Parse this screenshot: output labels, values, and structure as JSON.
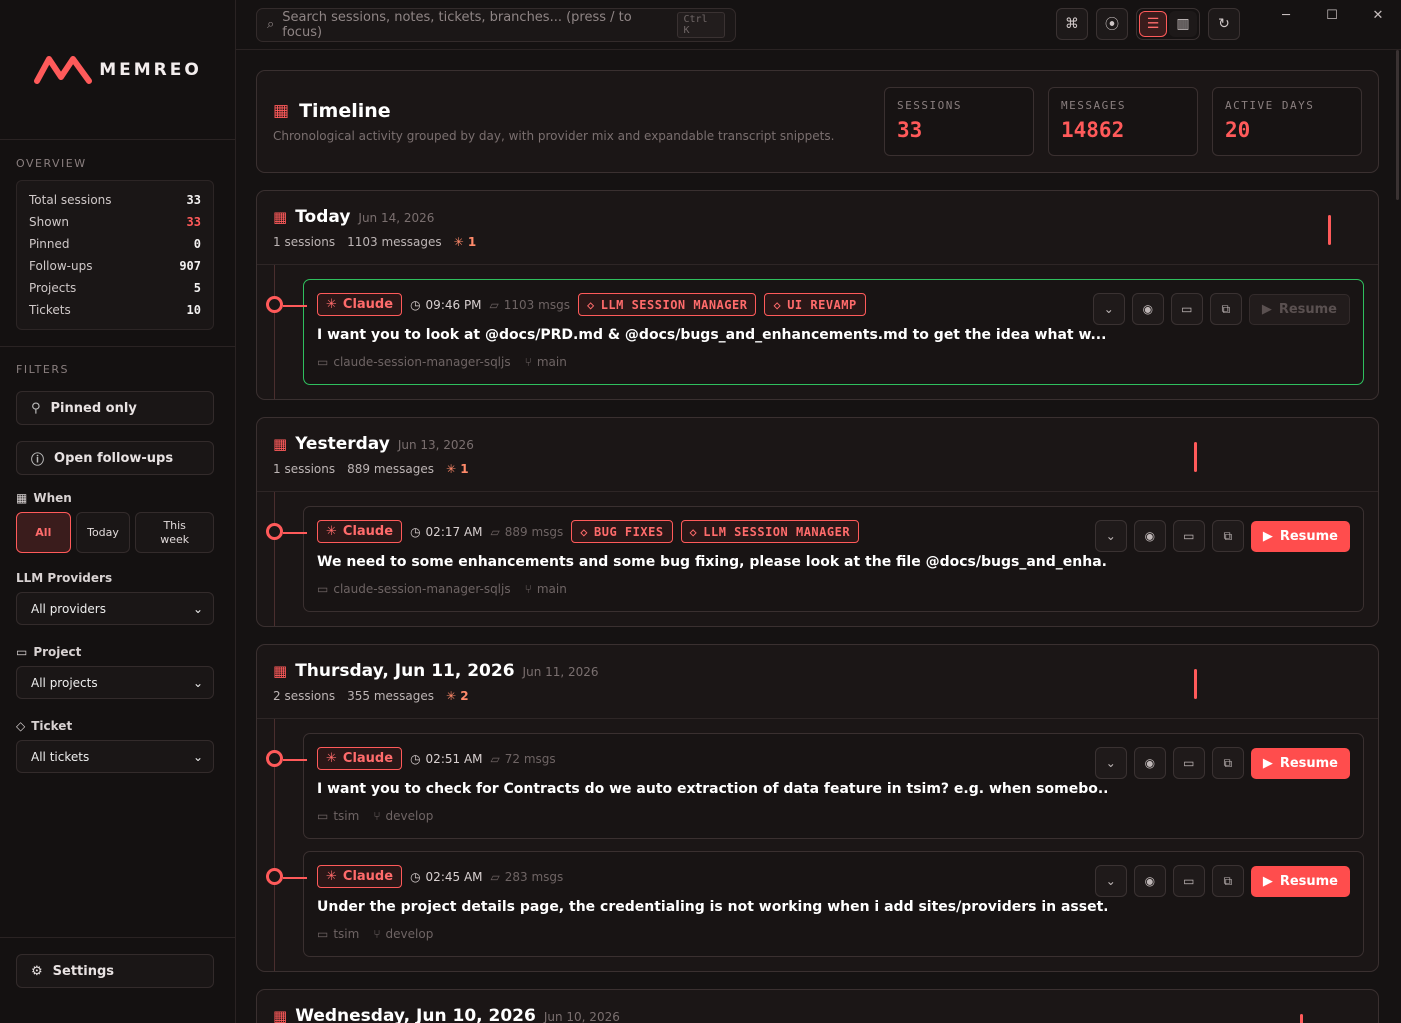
{
  "app": {
    "brand": "MEMREO"
  },
  "sidebar": {
    "overview_label": "OVERVIEW",
    "stats": [
      {
        "label": "Total sessions",
        "value": "33",
        "accent": false
      },
      {
        "label": "Shown",
        "value": "33",
        "accent": true
      },
      {
        "label": "Pinned",
        "value": "0",
        "accent": false
      },
      {
        "label": "Follow-ups",
        "value": "907",
        "accent": false
      },
      {
        "label": "Projects",
        "value": "5",
        "accent": false
      },
      {
        "label": "Tickets",
        "value": "10",
        "accent": false
      }
    ],
    "filters_label": "FILTERS",
    "pinned_only": "Pinned only",
    "open_followups": "Open follow-ups",
    "when_label": "When",
    "when_options": [
      "All",
      "Today",
      "This week"
    ],
    "providers_label": "LLM Providers",
    "providers_value": "All providers",
    "project_label": "Project",
    "project_value": "All projects",
    "ticket_label": "Ticket",
    "ticket_value": "All tickets",
    "settings": "Settings"
  },
  "topbar": {
    "search_placeholder": "Search sessions, notes, tickets, branches... (press / to focus)",
    "search_kbd": "Ctrl K"
  },
  "header": {
    "title": "Timeline",
    "subtitle": "Chronological activity grouped by day, with provider mix and expandable transcript snippets.",
    "kpis": [
      {
        "label": "SESSIONS",
        "value": "33"
      },
      {
        "label": "MESSAGES",
        "value": "14862"
      },
      {
        "label": "ACTIVE DAYS",
        "value": "20"
      }
    ]
  },
  "colors": {
    "accent": "#ff5a5a",
    "highlight": "#2fbf5e",
    "bg": "#151212"
  },
  "days": [
    {
      "title": "Today",
      "date": "Jun 14, 2026",
      "sessions": "1 sessions",
      "messages": "1103 messages",
      "prov_count": "1",
      "items": [
        {
          "provider": "Claude",
          "time": "09:46 PM",
          "msgs": "1103 msgs",
          "tags": [
            "LLM SESSION MANAGER",
            "UI REVAMP"
          ],
          "text": "I want you to look at @docs/PRD.md & @docs/bugs_and_enhancements.md to get the idea what w...",
          "project": "claude-session-manager-sqljs",
          "branch": "main",
          "resume": "Resume",
          "resume_disabled": true,
          "highlight": true
        }
      ]
    },
    {
      "title": "Yesterday",
      "date": "Jun 13, 2026",
      "sessions": "1 sessions",
      "messages": "889 messages",
      "prov_count": "1",
      "items": [
        {
          "provider": "Claude",
          "time": "02:17 AM",
          "msgs": "889 msgs",
          "tags": [
            "BUG FIXES",
            "LLM SESSION MANAGER"
          ],
          "text": "We need to some enhancements and some bug fixing, please look at the file @docs/bugs_and_enha...",
          "project": "claude-session-manager-sqljs",
          "branch": "main",
          "resume": "Resume",
          "resume_disabled": false,
          "highlight": false
        }
      ]
    },
    {
      "title": "Thursday, Jun 11, 2026",
      "date": "Jun 11, 2026",
      "sessions": "2 sessions",
      "messages": "355 messages",
      "prov_count": "2",
      "items": [
        {
          "provider": "Claude",
          "time": "02:51 AM",
          "msgs": "72 msgs",
          "tags": [],
          "text": "I want you to check for Contracts do we auto extraction of data feature in tsim? e.g. when somebo...",
          "project": "tsim",
          "branch": "develop",
          "resume": "Resume",
          "resume_disabled": false,
          "highlight": false
        },
        {
          "provider": "Claude",
          "time": "02:45 AM",
          "msgs": "283 msgs",
          "tags": [],
          "text": "Under the project details page, the credentialing is not working when i add sites/providers in asset...",
          "project": "tsim",
          "branch": "develop",
          "resume": "Resume",
          "resume_disabled": false,
          "highlight": false
        }
      ]
    },
    {
      "title": "Wednesday, Jun 10, 2026",
      "date": "Jun 10, 2026",
      "sessions": "",
      "messages": "",
      "prov_count": "",
      "items": []
    }
  ]
}
